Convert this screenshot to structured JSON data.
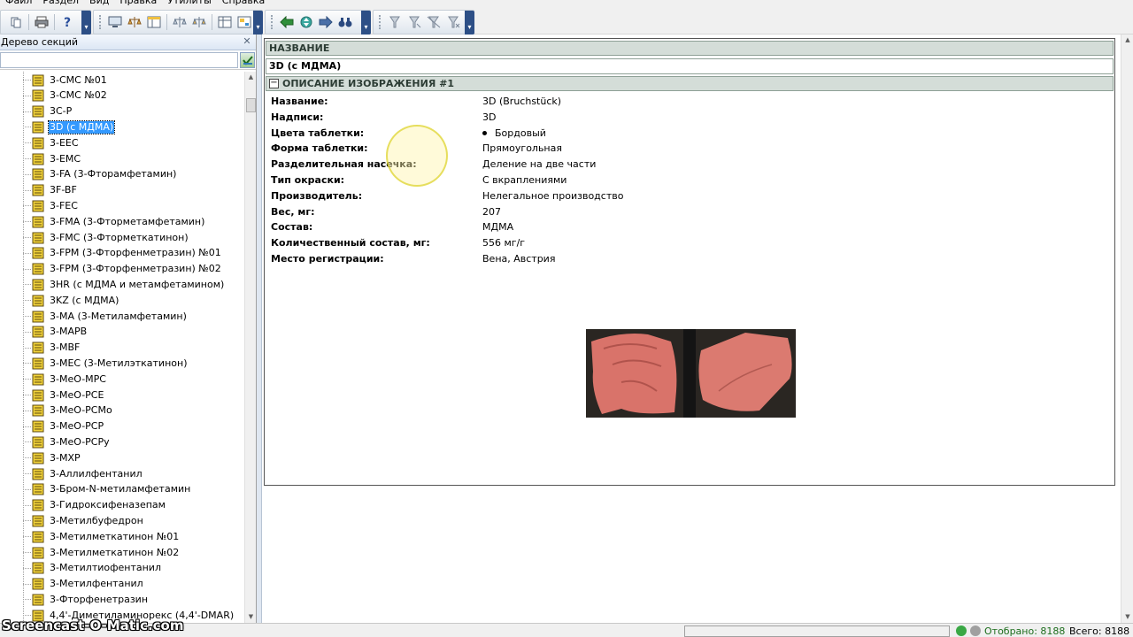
{
  "menu": [
    "Файл",
    "Раздел",
    "Вид",
    "Правка",
    "Утилиты",
    "Справка"
  ],
  "left_panel": {
    "title": "Дерево секций",
    "tree_items": [
      "3-CMC №01",
      "3-CMC №02",
      "3C-P",
      "3D (с МДМА)",
      "3-EEC",
      "3-EMC",
      "3-FA (3-Фторамфетамин)",
      "3F-BF",
      "3-FEC",
      "3-FMA (3-Фторметамфетамин)",
      "3-FMC (3-Фторметкатинон)",
      "3-FPM (3-Фторфенметразин) №01",
      "3-FPM (3-Фторфенметразин) №02",
      "3HR (с МДМА и метамфетамином)",
      "3KZ (с МДМА)",
      "3-MA (3-Метиламфетамин)",
      "3-MAPB",
      "3-MBF",
      "3-MEC (3-Метилэткатинон)",
      "3-MeO-MPC",
      "3-MeO-PCE",
      "3-MeO-PCMo",
      "3-MeO-PCP",
      "3-MeO-PCPy",
      "3-MXP",
      "3-Аллилфентанил",
      "3-Бром-N-метиламфетамин",
      "3-Гидроксифеназепам",
      "3-Метилбуфедрон",
      "3-Метилметкатинон №01",
      "3-Метилметкатинон №02",
      "3-Метилтиофентанил",
      "3-Метилфентанил",
      "3-Фторфенетразин",
      "4,4'-Диметиламинорекс (4,4'-DMAR)"
    ],
    "selected_index": 3
  },
  "detail": {
    "name_header": "НАЗВАНИЕ",
    "name_value": "3D (с МДМА)",
    "section_header": "ОПИСАНИЕ ИЗОБРАЖЕНИЯ #1",
    "properties": [
      {
        "key": "Название:",
        "value": "3D (Bruchstück)"
      },
      {
        "key": "Надписи:",
        "value": "3D"
      },
      {
        "key": "Цвета таблетки:",
        "value": "Бордовый"
      },
      {
        "key": "Форма таблетки:",
        "value": "Прямоугольная"
      },
      {
        "key": "Разделительная насечка:",
        "value": "Деление на две части"
      },
      {
        "key": "Тип окраски:",
        "value": "С вкраплениями"
      },
      {
        "key": "Производитель:",
        "value": "Нелегальное производство"
      },
      {
        "key": "Вес, мг:",
        "value": "207"
      },
      {
        "key": "Состав:",
        "value": "МДМА"
      },
      {
        "key": "Количественный состав, мг:",
        "value": "556 мг/г"
      },
      {
        "key": "Место регистрации:",
        "value": "Вена, Австрия"
      }
    ]
  },
  "status": {
    "shown": "Отобрано: 8188",
    "total": "Всего: 8188",
    "watermark": "Screencast-O-Matic.com"
  },
  "colors": {
    "selection": "#3399ff",
    "header_bar": "#d4ddd8",
    "tree_icon": "#f2d33a"
  }
}
